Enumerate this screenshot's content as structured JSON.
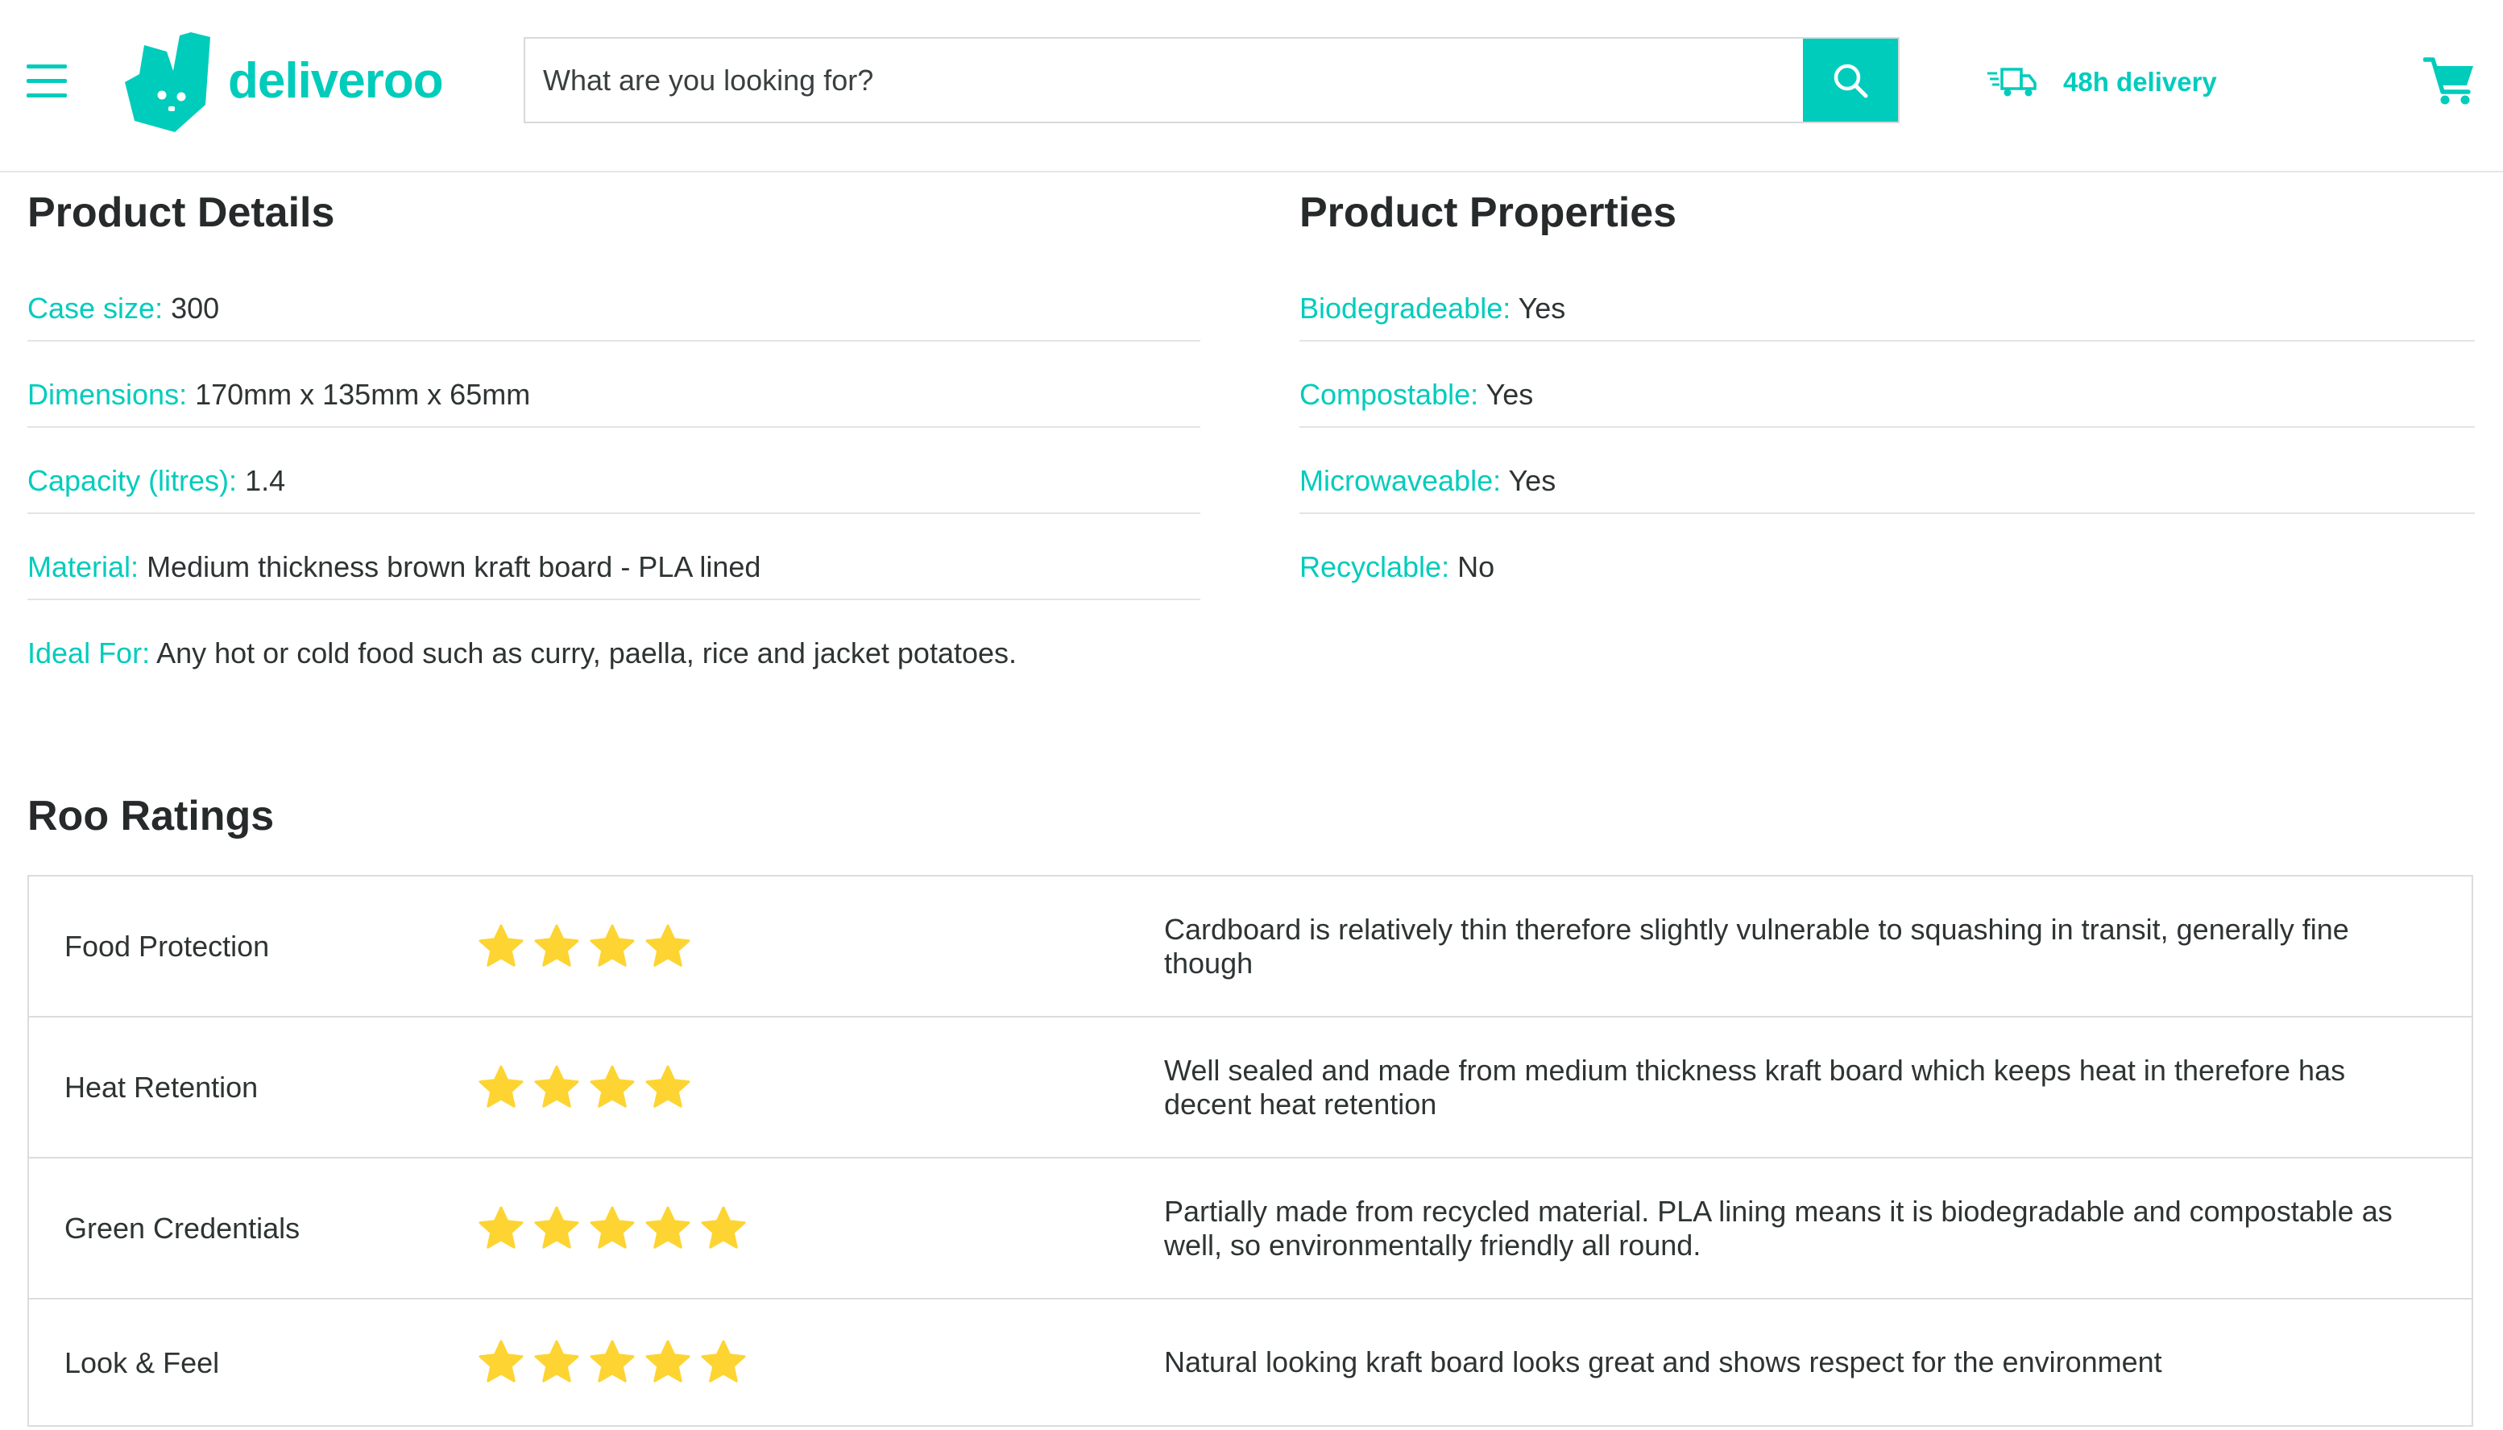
{
  "header": {
    "menu_icon": "hamburger-icon",
    "logo_icon": "deliveroo-kangaroo-icon",
    "logo_text": "deliveroo",
    "search": {
      "placeholder": "What are you looking for?",
      "value": "",
      "button_icon": "search-icon"
    },
    "delivery": {
      "icon": "delivery-truck-icon",
      "label": "48h delivery"
    },
    "cart_icon": "cart-icon"
  },
  "product_details": {
    "title": "Product Details",
    "rows": [
      {
        "label": "Case size:",
        "value": "300"
      },
      {
        "label": "Dimensions:",
        "value": "170mm x 135mm x 65mm"
      },
      {
        "label": "Capacity (litres):",
        "value": "1.4"
      },
      {
        "label": "Material:",
        "value": "Medium thickness brown kraft board - PLA lined"
      },
      {
        "label": "Ideal For:",
        "value": "Any hot or cold food such as curry, paella, rice and jacket potatoes."
      }
    ]
  },
  "product_properties": {
    "title": "Product Properties",
    "rows": [
      {
        "label": "Biodegradeable:",
        "value": "Yes"
      },
      {
        "label": "Compostable:",
        "value": "Yes"
      },
      {
        "label": "Microwaveable:",
        "value": "Yes"
      },
      {
        "label": "Recyclable:",
        "value": "No"
      }
    ]
  },
  "roo_ratings": {
    "title": "Roo Ratings",
    "star_icon": "star-icon",
    "rows": [
      {
        "name": "Food Protection",
        "rating": 4,
        "comment": "Cardboard is relatively thin therefore slightly vulnerable to squashing in transit, generally fine though"
      },
      {
        "name": "Heat Retention",
        "rating": 4,
        "comment": "Well sealed and made from medium thickness kraft board which keeps heat in therefore has decent heat retention"
      },
      {
        "name": "Green Credentials",
        "rating": 5,
        "comment": "Partially made from recycled material. PLA lining means it is biodegradable and compostable as well, so environmentally friendly all round."
      },
      {
        "name": "Look & Feel",
        "rating": 5,
        "comment": "Natural looking kraft board looks great and shows respect for the environment"
      }
    ]
  },
  "colors": {
    "accent": "#00ccbc",
    "text": "#2e3333",
    "star": "#fdd432",
    "border": "#dcdcdc"
  }
}
